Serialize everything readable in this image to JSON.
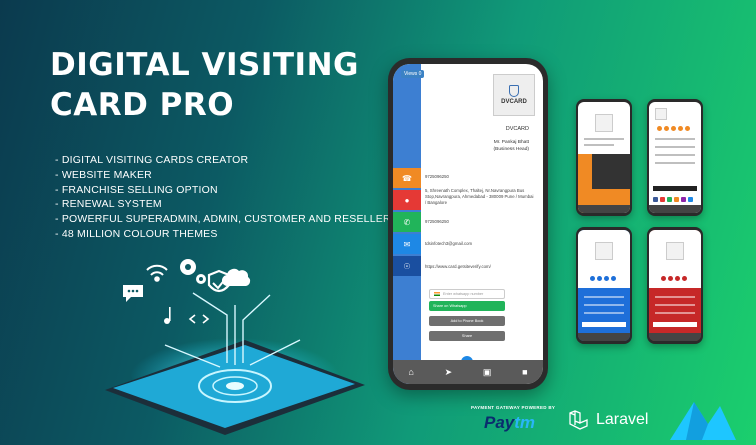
{
  "headline": {
    "line1": "DIGITAL VISITING",
    "line2": "CARD PRO"
  },
  "features": [
    "- DIGITAL VISITING CARDS CREATOR",
    "- WEBSITE MAKER",
    " - FRANCHISE SELLING OPTION",
    "- RENEWAL SYSTEM",
    "- POWERFUL SUPERADMIN, ADMIN, CUSTOMER AND RESELLER PANEL",
    "- 48 MILLION COLOUR THEMES"
  ],
  "phone": {
    "views_badge": "Views 0",
    "logo_text": "DVCARD",
    "company": "DVCARD",
    "person_name": "Mr. Pankaj Bhatt",
    "person_title": "(Business Head)",
    "phone1": "9725096250",
    "address": "5, Shreenath Complex, Thaltej, Nr.Navrangpura Bus Stop,Navrangpura, Ahmedabad - 380009 Pune / Mumbai / Bangalore",
    "phone2": "9725096250",
    "email": "tdsinfotech3@gmail.com",
    "website": "https://www.card.getsiteverify.com/",
    "whatsapp_placeholder": "Enter whatsapp number",
    "whatsapp_button": "Share on Whatsapp",
    "add_button": "Add to Phone Book",
    "share_button": "Share"
  },
  "brands": {
    "paytm_caption": "PAYMENT GATEWAY POWERED BY",
    "paytm_pay": "Pay",
    "paytm_tm": "tm",
    "laravel": "Laravel"
  },
  "colors": {
    "strip_blue": "#3d7fd2",
    "phone_orange": "#f08a24",
    "phone_red": "#e53935",
    "whatsapp_green": "#21b45a"
  },
  "icons": [
    "phone-icon",
    "map-pin-icon",
    "whatsapp-icon",
    "mail-icon",
    "globe-icon",
    "home-icon",
    "cart-icon",
    "share-icon"
  ]
}
